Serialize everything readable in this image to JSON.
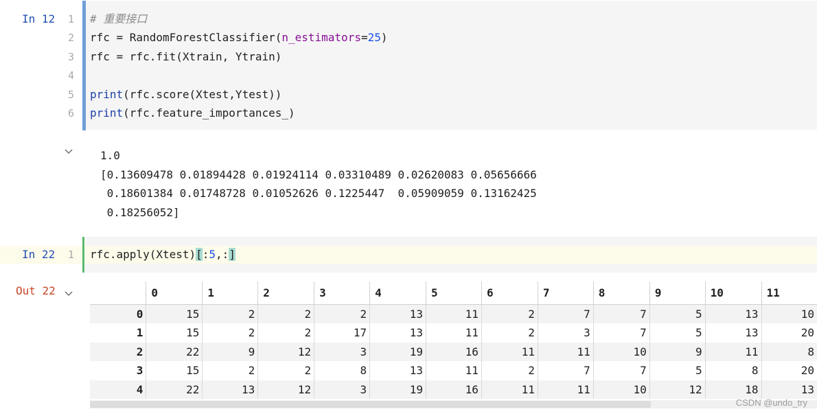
{
  "cell1": {
    "prompt": "In 12",
    "line_numbers": [
      "1",
      "2",
      "3",
      "4",
      "5",
      "6"
    ],
    "lines": [
      {
        "comment": "# 重要接口"
      },
      {
        "a": "rfc = RandomForestClassifier(",
        "kw": "n_estimators",
        "eq": "=",
        "num": "25",
        "b": ")"
      },
      {
        "a": "rfc = rfc.fit(Xtrain, Ytrain)"
      },
      {
        "a": ""
      },
      {
        "fn": "print",
        "a": "(rfc.score(Xtest,Ytest))"
      },
      {
        "fn": "print",
        "a": "(rfc.feature_importances_)"
      }
    ]
  },
  "output1": {
    "lines": [
      "1.0",
      "[0.13609478 0.01894428 0.01924114 0.03310489 0.02620083 0.05656666",
      " 0.18601384 0.01748728 0.01052626 0.1225447  0.05909059 0.13162425",
      " 0.18256052]"
    ]
  },
  "cell2": {
    "prompt": "In 22",
    "line_number": "1",
    "code_pre": "rfc.apply(Xtest)",
    "bracket_open": "[",
    "slice_colon": ":",
    "slice_num": "5",
    "slice_rest": ",:",
    "bracket_close": "]"
  },
  "output2": {
    "prompt": "Out 22",
    "columns": [
      "0",
      "1",
      "2",
      "3",
      "4",
      "5",
      "6",
      "7",
      "8",
      "9",
      "10",
      "11"
    ],
    "rows": [
      {
        "index": "0",
        "values": [
          "15",
          "2",
          "2",
          "2",
          "13",
          "11",
          "2",
          "7",
          "7",
          "5",
          "13",
          "10"
        ]
      },
      {
        "index": "1",
        "values": [
          "15",
          "2",
          "2",
          "17",
          "13",
          "11",
          "2",
          "3",
          "7",
          "5",
          "13",
          "20"
        ]
      },
      {
        "index": "2",
        "values": [
          "22",
          "9",
          "12",
          "3",
          "19",
          "16",
          "11",
          "11",
          "10",
          "9",
          "11",
          "8"
        ]
      },
      {
        "index": "3",
        "values": [
          "15",
          "2",
          "2",
          "8",
          "13",
          "11",
          "2",
          "7",
          "7",
          "5",
          "8",
          "20"
        ]
      },
      {
        "index": "4",
        "values": [
          "22",
          "13",
          "12",
          "3",
          "19",
          "16",
          "11",
          "11",
          "10",
          "12",
          "18",
          "13"
        ]
      }
    ]
  },
  "watermark": "CSDN @undo_try",
  "icons": {
    "collapse": "chevron-down-icon"
  },
  "colors": {
    "in_prompt": "#2450b4",
    "out_prompt": "#c4472b",
    "cell_bar_blue": "#6f9fd8",
    "cell_bar_green": "#5bb86a"
  }
}
